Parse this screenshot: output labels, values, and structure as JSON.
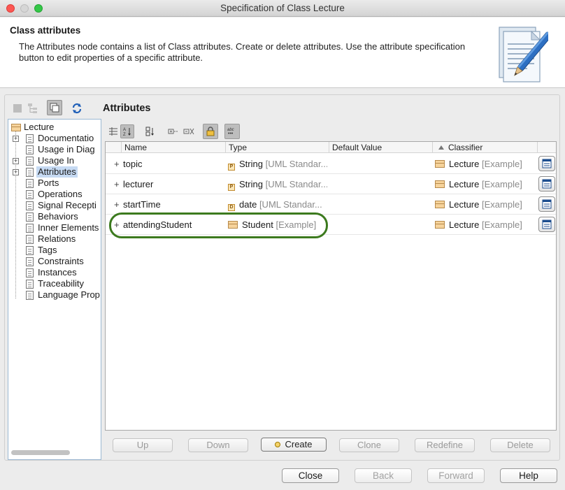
{
  "window": {
    "title": "Specification of Class Lecture"
  },
  "header": {
    "title": "Class attributes",
    "description": "The Attributes node contains a list of Class attributes. Create or delete attributes. Use the attribute specification button to edit properties of a specific attribute."
  },
  "tree": {
    "root": "Lecture",
    "items": [
      {
        "label": "Documentatio",
        "expandable": true
      },
      {
        "label": "Usage in Diag",
        "expandable": false
      },
      {
        "label": "Usage In",
        "expandable": true
      },
      {
        "label": "Attributes",
        "expandable": true,
        "selected": true
      },
      {
        "label": "Ports",
        "expandable": false
      },
      {
        "label": "Operations",
        "expandable": false
      },
      {
        "label": "Signal Recepti",
        "expandable": false
      },
      {
        "label": "Behaviors",
        "expandable": false
      },
      {
        "label": "Inner Elements",
        "expandable": false
      },
      {
        "label": "Relations",
        "expandable": false
      },
      {
        "label": "Tags",
        "expandable": false
      },
      {
        "label": "Constraints",
        "expandable": false
      },
      {
        "label": "Instances",
        "expandable": false
      },
      {
        "label": "Traceability",
        "expandable": false
      },
      {
        "label": "Language Prop",
        "expandable": false
      }
    ]
  },
  "section": {
    "title": "Attributes"
  },
  "table": {
    "columns": [
      "Name",
      "Type",
      "Default Value",
      "Classifier"
    ],
    "sort_column": "Classifier",
    "rows": [
      {
        "name": "topic",
        "type_icon": "P",
        "type": "String",
        "type_suffix": "[UML Standar...",
        "default": "",
        "classifier": "Lecture",
        "classifier_suffix": "[Example]"
      },
      {
        "name": "lecturer",
        "type_icon": "P",
        "type": "String",
        "type_suffix": "[UML Standar...",
        "default": "",
        "classifier": "Lecture",
        "classifier_suffix": "[Example]"
      },
      {
        "name": "startTime",
        "type_icon": "D",
        "type": "date",
        "type_suffix": "[UML Standar...",
        "default": "",
        "classifier": "Lecture",
        "classifier_suffix": "[Example]"
      },
      {
        "name": "attendingStudent",
        "type_icon": "class",
        "type": "Student",
        "type_suffix": "[Example]",
        "default": "",
        "classifier": "Lecture",
        "classifier_suffix": "[Example]"
      }
    ]
  },
  "actions": {
    "up": "Up",
    "down": "Down",
    "create": "Create",
    "clone": "Clone",
    "redefine": "Redefine",
    "delete": "Delete"
  },
  "footer": {
    "close": "Close",
    "back": "Back",
    "forward": "Forward",
    "help": "Help"
  },
  "colors": {
    "highlight_ring": "#3c7a1e",
    "tree_selection": "#c6daf3"
  }
}
